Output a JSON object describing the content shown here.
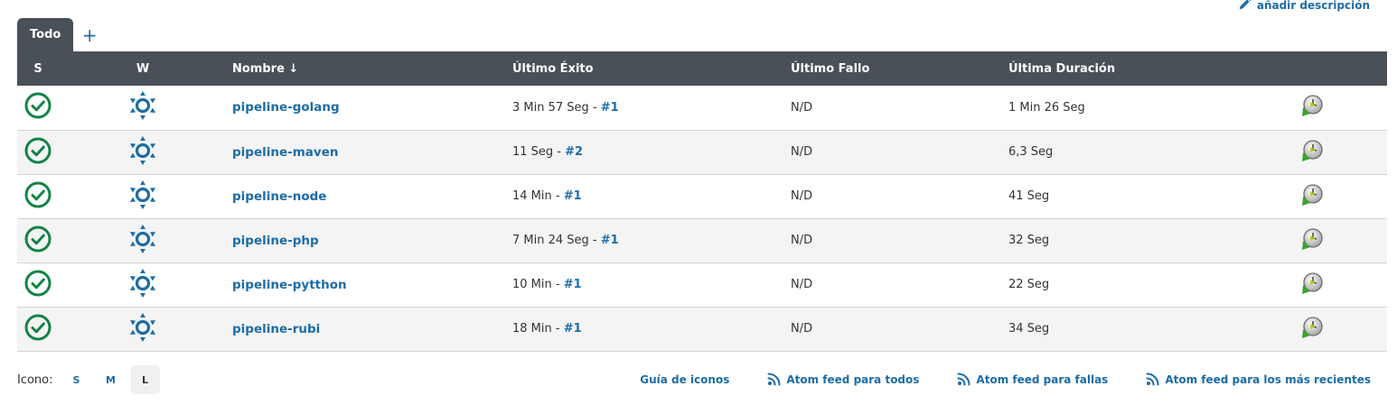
{
  "header": {
    "add_description": "añadir descripción"
  },
  "tabs": {
    "active": "Todo",
    "add_symbol": "+"
  },
  "table": {
    "columns": {
      "s": "S",
      "w": "W",
      "name": "Nombre  ↓",
      "last_success": "Último Éxito",
      "last_failure": "Último Fallo",
      "last_duration": "Última Duración"
    },
    "rows": [
      {
        "name": "pipeline-golang",
        "success_time": "3 Min 57 Seg - ",
        "success_build": "#1",
        "failure": "N/D",
        "duration": "1 Min 26 Seg"
      },
      {
        "name": "pipeline-maven",
        "success_time": "11 Seg - ",
        "success_build": "#2",
        "failure": "N/D",
        "duration": "6,3 Seg"
      },
      {
        "name": "pipeline-node",
        "success_time": "14 Min - ",
        "success_build": "#1",
        "failure": "N/D",
        "duration": "41 Seg"
      },
      {
        "name": "pipeline-php",
        "success_time": "7 Min 24 Seg - ",
        "success_build": "#1",
        "failure": "N/D",
        "duration": "32 Seg"
      },
      {
        "name": "pipeline-pytthon",
        "success_time": "10 Min - ",
        "success_build": "#1",
        "failure": "N/D",
        "duration": "22 Seg"
      },
      {
        "name": "pipeline-rubi",
        "success_time": "18 Min - ",
        "success_build": "#1",
        "failure": "N/D",
        "duration": "34 Seg"
      }
    ]
  },
  "footer": {
    "icon_label": "Icono:",
    "sizes": [
      "S",
      "M",
      "L"
    ],
    "active_size": "L",
    "links": [
      "Guía de iconos",
      "Atom feed para todos",
      "Atom feed para fallas",
      "Atom feed para los más recientes"
    ]
  },
  "colors": {
    "header_bg": "#4a5058",
    "link": "#1c6ca6",
    "success": "#138347",
    "weather": "#1c6ca6"
  },
  "icons": {
    "status": "success-check-circle-icon",
    "weather": "sunny-weather-icon",
    "run": "schedule-build-clock-icon",
    "feed": "rss-feed-icon",
    "edit": "pencil-icon"
  }
}
